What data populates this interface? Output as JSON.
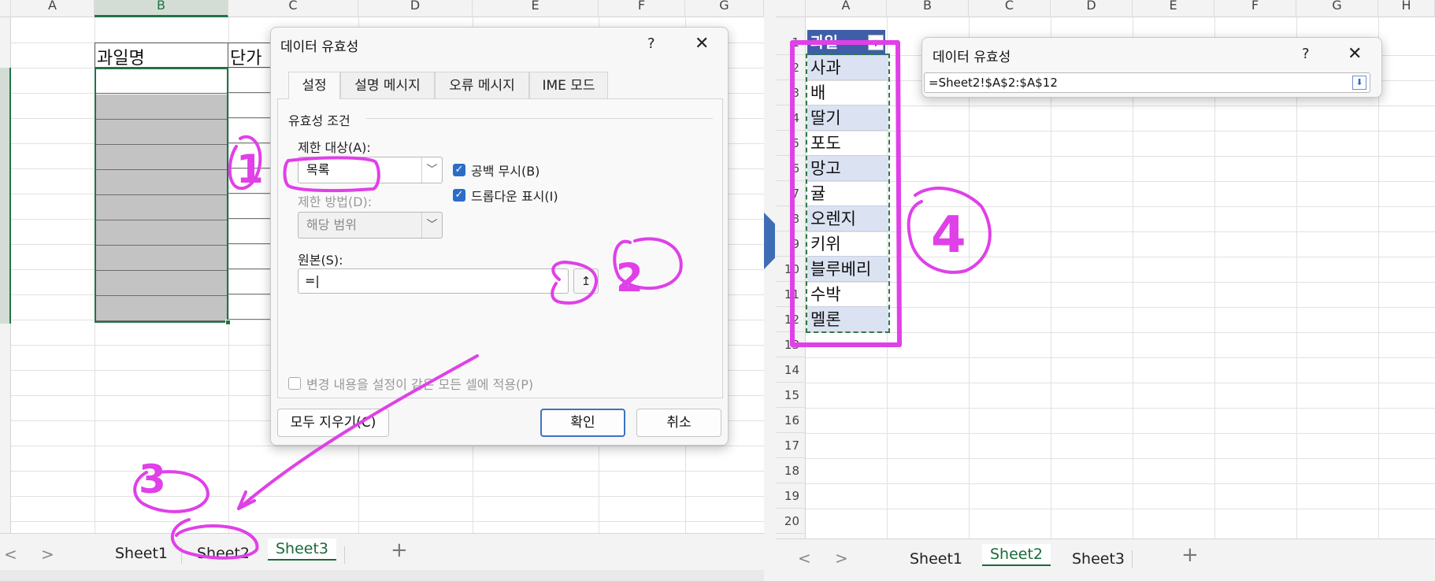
{
  "left_sheet": {
    "column_headers": [
      "A",
      "B",
      "C",
      "D",
      "E",
      "F",
      "G"
    ],
    "header_cells": {
      "b2": "과일명",
      "c2": "단가"
    },
    "sheet_tabs": [
      "Sheet1",
      "Sheet2",
      "Sheet3"
    ],
    "active_tab": "Sheet3",
    "nav_prev": "<",
    "nav_next": ">",
    "add_sheet": "+"
  },
  "dialog": {
    "title": "데이터 유효성",
    "help": "?",
    "close": "✕",
    "tabs": [
      "설정",
      "설명 메시지",
      "오류 메시지",
      "IME 모드"
    ],
    "active_tab": "설정",
    "section_title": "유효성 조건",
    "allow_label": "제한 대상(A):",
    "allow_value": "목록",
    "data_label": "제한 방법(D):",
    "data_value": "해당 범위",
    "ignore_blank_label": "공백 무시(B)",
    "dropdown_label": "드롭다운 표시(I)",
    "source_label": "원본(S):",
    "source_value": "=|",
    "pick_icon": "↥",
    "apply_all_label": "변경 내용을 설정이 같은 모든 셀에 적용(P)",
    "clear_all": "모두 지우기(C)",
    "ok": "확인",
    "cancel": "취소"
  },
  "right_sheet": {
    "column_headers": [
      "A",
      "B",
      "C",
      "D",
      "E",
      "F",
      "G",
      "H"
    ],
    "row_numbers": [
      "1",
      "2",
      "3",
      "4",
      "5",
      "6",
      "7",
      "8",
      "9",
      "10",
      "11",
      "12",
      "13",
      "14",
      "15",
      "16",
      "17",
      "18",
      "19",
      "20"
    ],
    "a1_header": "과일",
    "fruits": [
      "사과",
      "배",
      "딸기",
      "포도",
      "망고",
      "귤",
      "오렌지",
      "키위",
      "블루베리",
      "수박",
      "멜론"
    ],
    "sheet_tabs": [
      "Sheet1",
      "Sheet2",
      "Sheet3"
    ],
    "active_tab": "Sheet2",
    "nav_prev": "<",
    "nav_next": ">",
    "add_sheet": "+"
  },
  "mini_dialog": {
    "title": "데이터 유효성",
    "help": "?",
    "close": "✕",
    "range_value": "=Sheet2!$A$2:$A$12",
    "collapse_icon": "⬇"
  },
  "annotations": [
    "1",
    "2",
    "3",
    "4"
  ],
  "colors": {
    "annotation": "#e040e8",
    "excel_green": "#217346",
    "dialog_blue": "#2c6dc7",
    "table_header": "#3e5fa8",
    "table_band": "#dbe2f2",
    "gray_cells": "#c3c3c3"
  }
}
